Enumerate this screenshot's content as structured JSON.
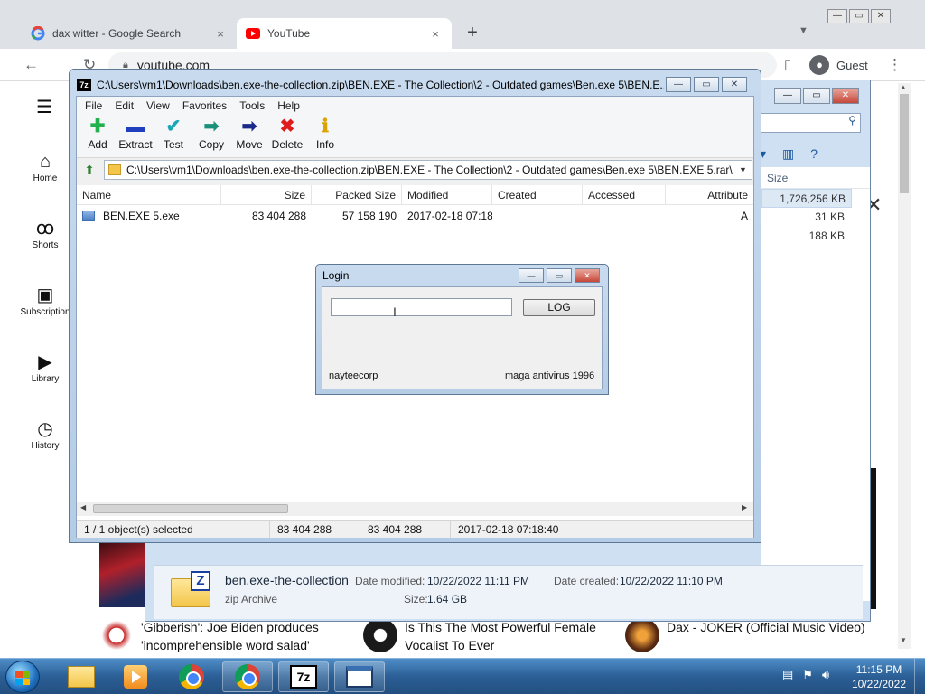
{
  "browser": {
    "tabs": [
      {
        "label": "dax witter - Google Search",
        "icon": "google-g-icon"
      },
      {
        "label": "YouTube",
        "icon": "youtube-icon"
      }
    ],
    "new_tab": "+",
    "address": "youtube.com",
    "profile": "Guest",
    "close_glyph": "×",
    "min_glyph": "—"
  },
  "youtube": {
    "sidebar": [
      {
        "label": "Home",
        "icon": "home-icon",
        "glyph": "⌂"
      },
      {
        "label": "Shorts",
        "icon": "shorts-icon",
        "glyph": "ꝏ"
      },
      {
        "label": "Subscription",
        "icon": "subscriptions-icon",
        "glyph": "▣"
      },
      {
        "label": "Library",
        "icon": "library-icon",
        "glyph": "▶"
      },
      {
        "label": "History",
        "icon": "history-icon",
        "glyph": "◷"
      }
    ],
    "videos": [
      {
        "title": "'Gibberish': Joe Biden produces 'incomprehensible word salad'"
      },
      {
        "title": "Is This The Most Powerful Female Vocalist To Ever"
      },
      {
        "title": "Dax - JOKER (Official Music Video)"
      }
    ]
  },
  "explorer": {
    "list_header": "Size",
    "sizes": [
      "1,726,256 KB",
      "31 KB",
      "188 KB"
    ],
    "details": {
      "name": "ben.exe-the-collection",
      "type": "zip Archive",
      "modified_label": "Date modified:",
      "modified": "10/22/2022 11:11 PM",
      "created_label": "Date created:",
      "created": "10/22/2022 11:10 PM",
      "size_label": "Size:",
      "size": "1.64 GB"
    }
  },
  "sevenzip": {
    "title": "C:\\Users\\vm1\\Downloads\\ben.exe-the-collection.zip\\BEN.EXE - The Collection\\2 - Outdated games\\Ben.exe 5\\BEN.E...",
    "logo": "7z",
    "menu": [
      "File",
      "Edit",
      "View",
      "Favorites",
      "Tools",
      "Help"
    ],
    "toolbar": [
      {
        "label": "Add",
        "icon": "add-icon",
        "glyph": "✚",
        "color": "#22b14c"
      },
      {
        "label": "Extract",
        "icon": "extract-icon",
        "glyph": "▬",
        "color": "#1f3fbf"
      },
      {
        "label": "Test",
        "icon": "test-icon",
        "glyph": "✔",
        "color": "#1aa6b7"
      },
      {
        "label": "Copy",
        "icon": "copy-icon",
        "glyph": "➡",
        "color": "#1a8f7a"
      },
      {
        "label": "Move",
        "icon": "move-icon",
        "glyph": "➡",
        "color": "#1b2a8a"
      },
      {
        "label": "Delete",
        "icon": "delete-icon",
        "glyph": "✖",
        "color": "#e01b1b"
      },
      {
        "label": "Info",
        "icon": "info-icon",
        "glyph": "ℹ",
        "color": "#d9a400"
      }
    ],
    "path": "C:\\Users\\vm1\\Downloads\\ben.exe-the-collection.zip\\BEN.EXE - The Collection\\2 - Outdated games\\Ben.exe 5\\BEN.EXE 5.rar\\",
    "columns": [
      "Name",
      "Size",
      "Packed Size",
      "Modified",
      "Created",
      "Accessed",
      "Attribute"
    ],
    "rows": [
      {
        "name": "BEN.EXE 5.exe",
        "size": "83 404 288",
        "packed": "57 158 190",
        "modified": "2017-02-18 07:18",
        "created": "",
        "accessed": "",
        "attr": "A"
      }
    ],
    "status": {
      "selected": "1 / 1 object(s) selected",
      "size": "83 404 288",
      "packed": "83 404 288",
      "modified": "2017-02-18 07:18:40"
    }
  },
  "login": {
    "title": "Login",
    "input_value": "",
    "button": "LOG",
    "left_text": "nayteecorp",
    "right_text": "maga antivirus 1996"
  },
  "taskbar": {
    "time": "11:15 PM",
    "date": "10/22/2022"
  },
  "colors": {
    "taskbar": "#2b5f96",
    "window_frame": "#b4cce6",
    "chrome_tabstrip": "#dee1e6"
  }
}
